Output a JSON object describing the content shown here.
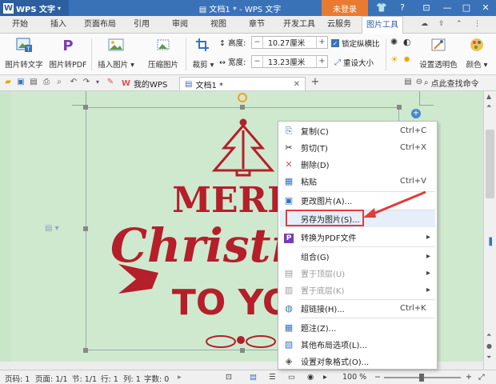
{
  "titlebar": {
    "app_name": "WPS 文字",
    "doc_title": "文档1 * - WPS 文字",
    "login": "未登录"
  },
  "menu_tabs": [
    "开始",
    "插入",
    "页面布局",
    "引用",
    "审阅",
    "视图",
    "章节",
    "开发工具",
    "云服务",
    "图片工具"
  ],
  "ribbon": {
    "pic_to_text": "图片转文字",
    "pic_to_pdf": "图片转PDF",
    "insert_pic": "插入图片",
    "compress_pic": "压缩图片",
    "crop": "裁剪",
    "height_label": "高度:",
    "height_value": "10.27厘米",
    "width_label": "宽度:",
    "width_value": "13.23厘米",
    "lock_ratio": "锁定纵横比",
    "reset_size": "重设大小",
    "set_transparent": "设置透明色",
    "color": "颜色"
  },
  "doctabs": {
    "my_wps": "我的WPS",
    "doc1": "文档1 *",
    "search_cmd": "点此查找命令"
  },
  "context_menu": [
    {
      "label": "复制(C)",
      "shortcut": "Ctrl+C",
      "icon": "copy-icon",
      "glyph": "⎘"
    },
    {
      "label": "剪切(T)",
      "shortcut": "Ctrl+X",
      "icon": "cut-icon",
      "glyph": "✂"
    },
    {
      "label": "删除(D)",
      "shortcut": "",
      "icon": "delete-icon",
      "glyph": "✕"
    },
    {
      "label": "粘贴",
      "shortcut": "Ctrl+V",
      "icon": "paste-icon",
      "glyph": "📋"
    },
    {
      "label": "更改图片(A)...",
      "shortcut": "",
      "icon": "change-image-icon",
      "glyph": "▣"
    },
    {
      "label": "另存为图片(S)...",
      "shortcut": "",
      "icon": "",
      "glyph": ""
    },
    {
      "label": "转换为PDF文件",
      "shortcut": "▸",
      "icon": "pdf-icon",
      "glyph": "P"
    },
    {
      "label": "组合(G)",
      "shortcut": "▸",
      "icon": "",
      "glyph": ""
    },
    {
      "label": "置于顶层(U)",
      "shortcut": "▸",
      "icon": "bring-front-icon",
      "glyph": "▤"
    },
    {
      "label": "置于底层(K)",
      "shortcut": "▸",
      "icon": "send-back-icon",
      "glyph": "▥"
    },
    {
      "label": "超链接(H)...",
      "shortcut": "Ctrl+K",
      "icon": "hyperlink-icon",
      "glyph": "🌐"
    },
    {
      "label": "题注(Z)...",
      "shortcut": "",
      "icon": "caption-icon",
      "glyph": "▦"
    },
    {
      "label": "其他布局选项(L)...",
      "shortcut": "",
      "icon": "layout-icon",
      "glyph": "▧"
    },
    {
      "label": "设置对象格式(O)...",
      "shortcut": "",
      "icon": "format-icon",
      "glyph": "◈"
    }
  ],
  "image_text": {
    "line1": "MERRY",
    "line2": "Christmas",
    "line3": "TO YOU"
  },
  "statusbar": {
    "page": "页码: 1",
    "pages": "页面: 1/1",
    "section": "节: 1/1",
    "row": "行: 1",
    "col": "列: 1",
    "words": "字数: 0",
    "zoom": "100 %"
  },
  "colors": {
    "title_blue": "#3a72b8",
    "login_orange": "#e87a32",
    "doc_green": "#c9e6c9",
    "christmas_red": "#b41f2a",
    "highlight_red": "#e23b3b"
  }
}
